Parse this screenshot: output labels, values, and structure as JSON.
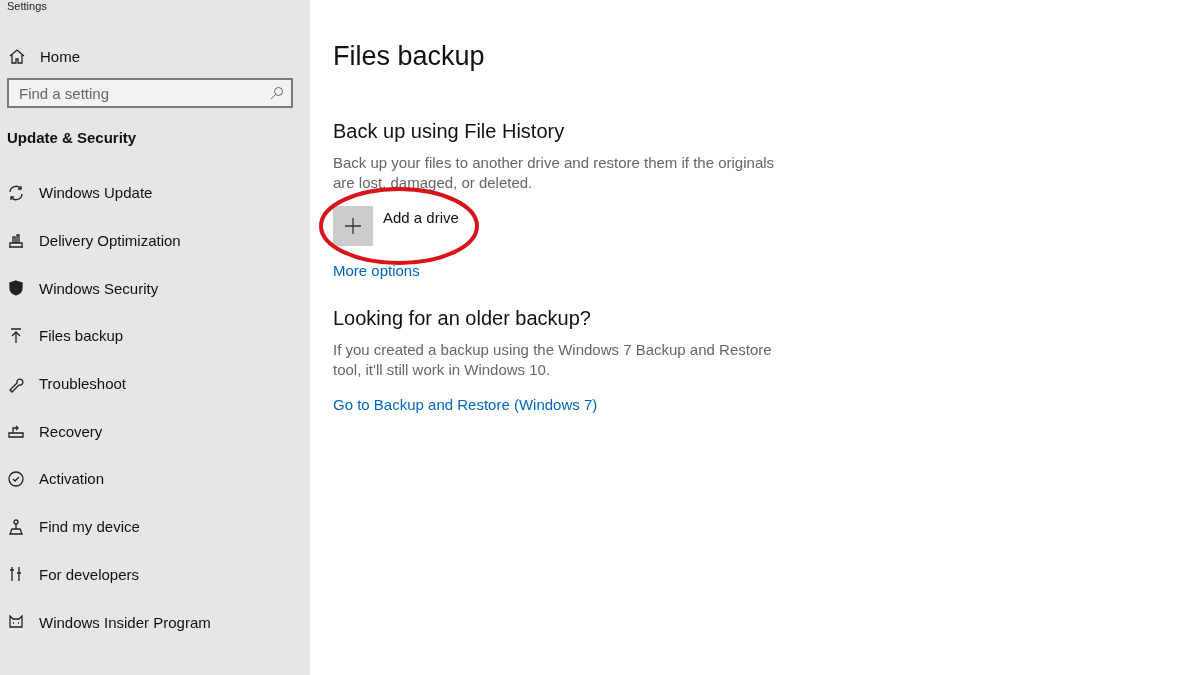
{
  "window": {
    "title": "Settings"
  },
  "sidebar": {
    "home": "Home",
    "search": {
      "placeholder": "Find a setting"
    },
    "section": "Update & Security",
    "items": [
      {
        "label": "Windows Update"
      },
      {
        "label": "Delivery Optimization"
      },
      {
        "label": "Windows Security"
      },
      {
        "label": "Files backup"
      },
      {
        "label": "Troubleshoot"
      },
      {
        "label": "Recovery"
      },
      {
        "label": "Activation"
      },
      {
        "label": "Find my device"
      },
      {
        "label": "For developers"
      },
      {
        "label": "Windows Insider Program"
      }
    ]
  },
  "page": {
    "title": "Files backup",
    "sections": [
      {
        "heading": "Back up using File History",
        "description": "Back up your files to another drive and restore them if the originals are lost, damaged, or deleted.",
        "add_button": "Add a drive",
        "link": "More options"
      },
      {
        "heading": "Looking for an older backup?",
        "description": "If you created a backup using the Windows 7 Backup and Restore tool, it'll still work in Windows 10.",
        "link": "Go to Backup and Restore (Windows 7)"
      }
    ]
  },
  "annotation": {
    "kind": "ellipse"
  }
}
